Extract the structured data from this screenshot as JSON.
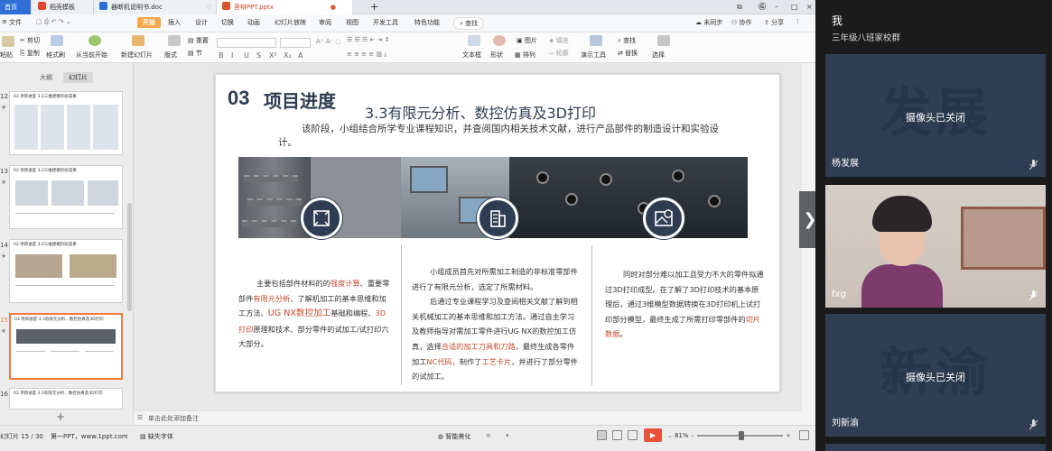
{
  "tabs": {
    "home": "首页",
    "doc1": "稻壳模板",
    "doc2": "器断机说明书.doc",
    "ppt": "答辩PPT.pptx"
  },
  "menu": {
    "file": "文件",
    "start": "开始",
    "insert": "插入",
    "design": "设计",
    "switch": "切换",
    "animation": "动画",
    "slideshow": "幻灯片放映",
    "review": "审阅",
    "view": "视图",
    "devtools": "开发工具",
    "special": "特色功能",
    "search": "查找",
    "unsync": "未同步",
    "collab": "协作",
    "share": "分享"
  },
  "ribbon": {
    "cut": "剪切",
    "copy": "复制",
    "format_painter": "格式刷",
    "paste": "粘贴",
    "from_current": "从当前开始",
    "new_slide": "新建幻灯片",
    "layout": "版式",
    "section": "节",
    "reset": "重置",
    "textbox": "文本框",
    "shape": "形状",
    "arrange": "排列",
    "picture": "图片",
    "fill": "填充",
    "outline": "轮廓",
    "presentation_tools": "演示工具",
    "find": "查找",
    "replace": "替换",
    "select": "选择",
    "font_format": [
      "B",
      "I",
      "U",
      "S",
      "X²",
      "X₂",
      "A"
    ]
  },
  "left_panel": {
    "tab_outline": "大纲",
    "tab_slides": "幻灯片",
    "slides": [
      {
        "num": "12",
        "title": "03 项目进度  3.2三维建模阶段成果"
      },
      {
        "num": "13",
        "title": "03 项目进度  3.2三维建模阶段成果"
      },
      {
        "num": "14",
        "title": "03 项目进度  3.2三维建模阶段成果"
      },
      {
        "num": "15",
        "title": "03 项目进度  3.3有限元分析、数控仿真及3D打印"
      },
      {
        "num": "16",
        "title": "03 项目进度  3.3有限元分析、数控仿真及3D打印"
      }
    ],
    "add": "+"
  },
  "slide": {
    "num": "03",
    "heading": "项目进度",
    "subheading": "3.3有限元分析、数控仿真及3D打印",
    "intro": "该阶段，小组结合所学专业课程知识，并查阅国内相关技术文献，进行产品部件的制造设计和实验设计。",
    "col1": {
      "p1a": "主要包括部件材料的的",
      "h1": "强度计算",
      "p1b": "、重要零部件",
      "h2": "有限元分析",
      "p1c": "、了解机加工的基本思维和加工方法、",
      "h3": "UG NX数控加工",
      "p1d": "基础和编程、",
      "h4": "3D打印",
      "p1e": "原理和技术、部分零件的试加工/试打印六大部分。"
    },
    "col2": {
      "p1": "小组成员首先对所需加工制造的非标准零部件进行了有限元分析，选定了所需材料。",
      "p2a": "后通过专业课程学习及查阅相关文献了解到相关机械加工的基本思维和加工方法。通过自主学习及教师指导对需加工零件进行UG NX的数控加工仿真，选择",
      "h1": "合适的加工刀具和刀路",
      "p2b": "，最终生成各零件加工",
      "h2": "NC代码",
      "p2c": "，制作了",
      "h3": "工艺卡片",
      "p2d": "，并进行了部分零件的试加工。"
    },
    "col3": {
      "p1a": "同时对部分难以加工且受力不大的零件拟通过3D打印成型。在了解了3D打印技术的基本原理后，通过3维模型数据转换在3D打印机上试打印部分模型，最终生成了所需打印零部件的",
      "h1": "切片数据",
      "p1b": "。"
    }
  },
  "notes": "单击此处添加备注",
  "status": {
    "slide_count": "幻灯片 15 / 30",
    "theme": "第一PPT，www.1ppt.com",
    "missing_font": "缺失字体",
    "beautify": "智能美化",
    "zoom": "81%"
  },
  "participants": [
    {
      "name": "我",
      "group": "三年级八班家校群"
    },
    {
      "name": "杨发展",
      "big": "发展",
      "status": "摄像头已关闭"
    },
    {
      "name": "fxg"
    },
    {
      "name": "刘新渝",
      "big": "新渝",
      "status": "摄像头已关闭"
    }
  ],
  "colors": {
    "accent_orange": "#f7a64b",
    "slide_navy": "#2e3d52",
    "highlight_red": "#c34a2c",
    "tile_bg": "#2f3e52"
  }
}
